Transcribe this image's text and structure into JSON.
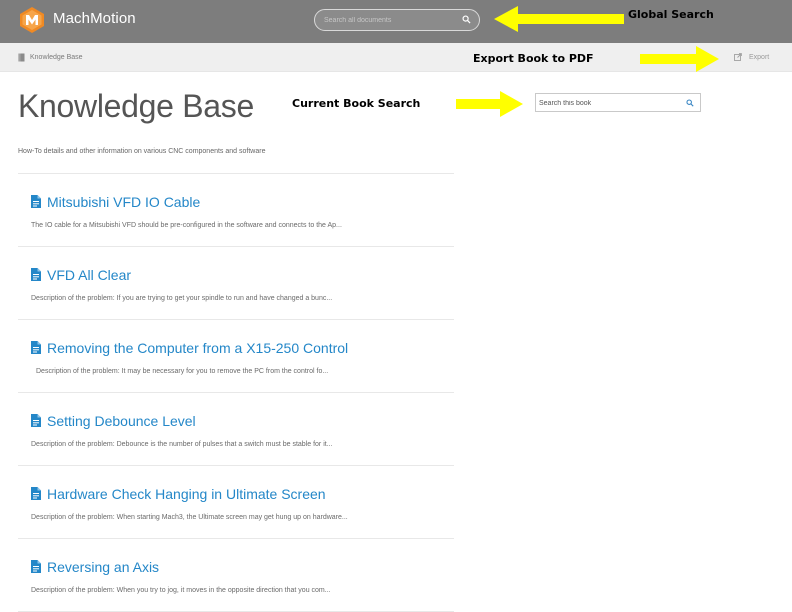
{
  "header": {
    "brand": "MachMotion",
    "global_search_placeholder": "Search all documents"
  },
  "breadcrumb": {
    "label": "Knowledge Base",
    "export_label": "Export"
  },
  "page": {
    "title": "Knowledge Base",
    "book_search_placeholder": "Search this book",
    "subtitle": "How-To details and other information on various CNC components and software"
  },
  "articles": [
    {
      "title": "Mitsubishi VFD IO Cable",
      "excerpt": "The IO cable for a Mitsubishi VFD should be pre-configured in the software and connects to the Ap..."
    },
    {
      "title": "VFD All Clear",
      "excerpt": "Description of the problem: If you are trying to get your spindle to run and have changed a bunc..."
    },
    {
      "title": "Removing the Computer from a X15-250 Control",
      "excerpt": "Description of the problem: It may be necessary for you to remove the PC from the control fo..."
    },
    {
      "title": "Setting Debounce Level",
      "excerpt": "Description of the problem: Debounce is the number of pulses that a switch must be stable for it..."
    },
    {
      "title": "Hardware Check Hanging in Ultimate Screen",
      "excerpt": "Description of the problem: When starting Mach3, the Ultimate screen may get hung up on hardware..."
    },
    {
      "title": "Reversing an Axis",
      "excerpt": "Description of the problem: When you try to jog, it moves in the opposite direction that you com..."
    }
  ],
  "annotations": {
    "global_search": "Global Search",
    "export_pdf": "Export Book to PDF",
    "book_search": "Current Book Search"
  },
  "colors": {
    "header_bg": "#7d7d7d",
    "link": "#2487c8",
    "logo_orange": "#f08a24",
    "annotation_arrow": "#ffff00"
  },
  "icons": {
    "logo": "machmotion-logo-icon",
    "global_search": "search-icon",
    "breadcrumb": "book-icon",
    "export": "export-icon",
    "book_search": "search-icon",
    "article": "document-icon"
  }
}
